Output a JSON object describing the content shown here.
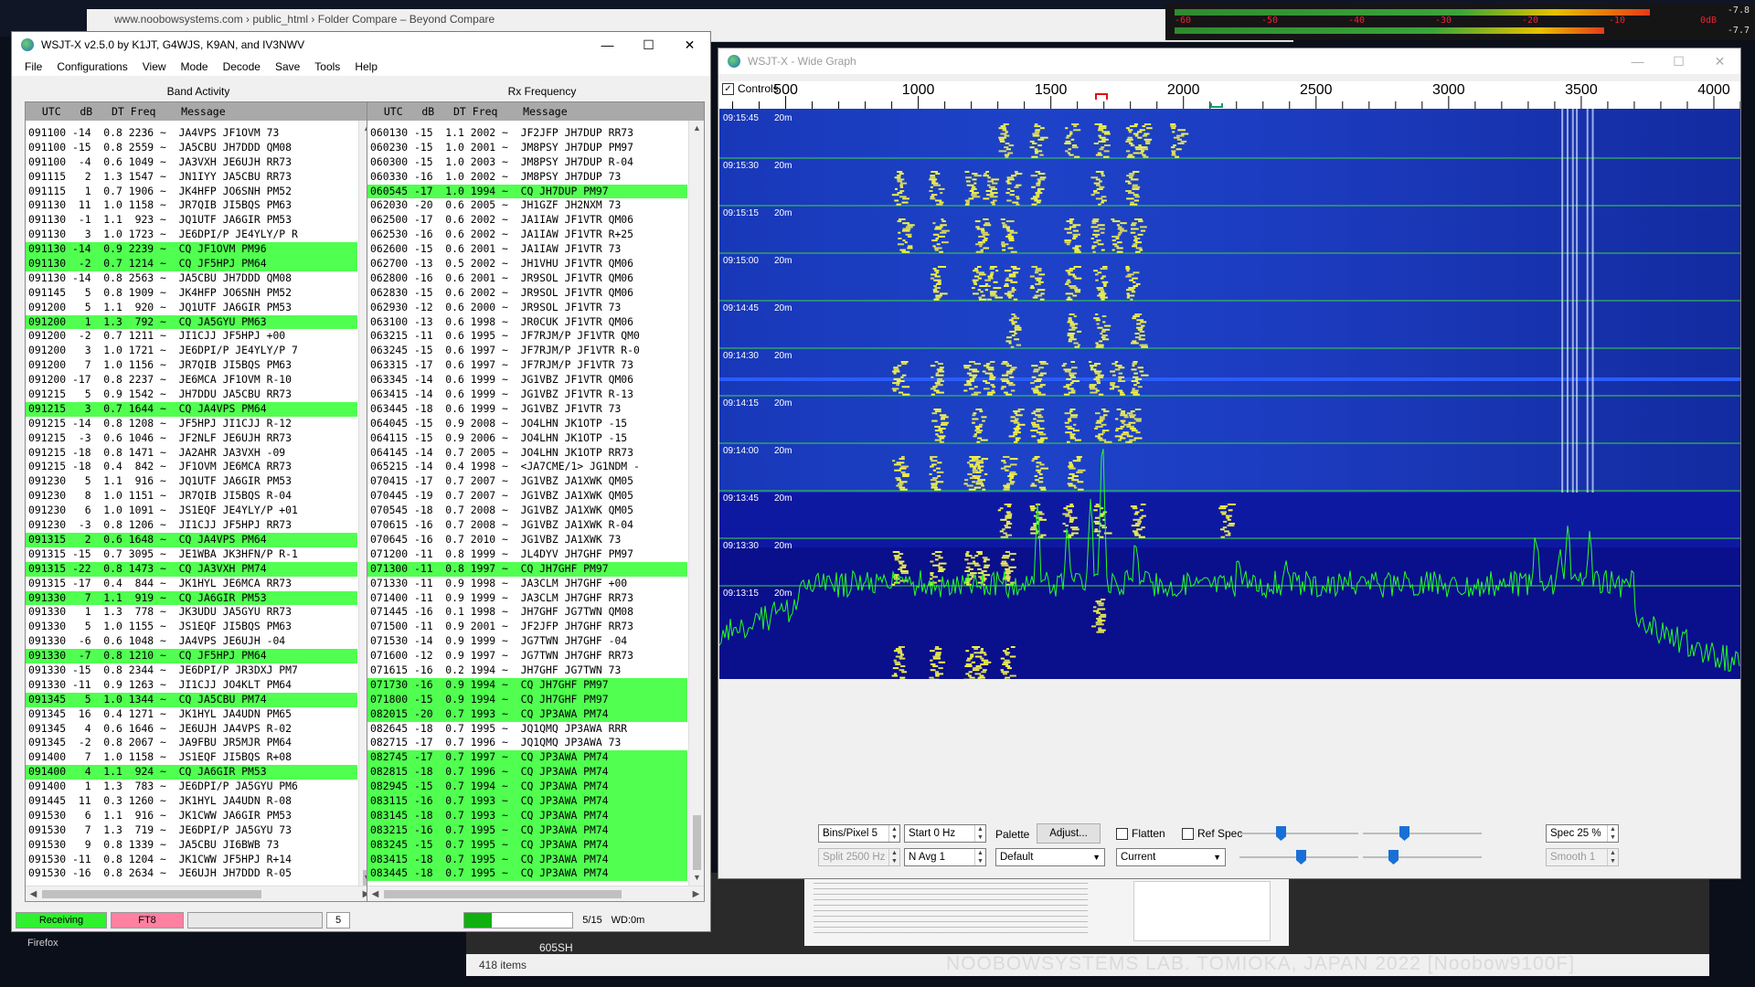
{
  "background": {
    "explorer_title": "www.noobowsystems.com  ›  public_html  ›  Folder Compare – Beyond Compare",
    "meter_scale": [
      "-60",
      "-50",
      "-40",
      "-30",
      "-20",
      "-10",
      "0dB"
    ],
    "meter_right_values": [
      "-7.8",
      "-7.7"
    ],
    "items_count": "418 items",
    "file_label": "605SH",
    "taskbar_label": "Firefox",
    "watermark": "NOOBOWSYSTEMS LAB. TOMIOKA, JAPAN 2022 [Noobow9100F]"
  },
  "wsjt": {
    "title": "WSJT-X   v2.5.0   by K1JT, G4WJS, K9AN, and IV3NWV",
    "menu": [
      "File",
      "Configurations",
      "View",
      "Mode",
      "Decode",
      "Save",
      "Tools",
      "Help"
    ],
    "band_title": "Band Activity",
    "rx_title": "Rx Frequency",
    "header": "  UTC   dB   DT Freq    Message",
    "band_rows": [
      {
        "t": "091100 -14  0.8 2236 ~  JA4VPS JF1OVM 73",
        "cq": false
      },
      {
        "t": "091100 -15  0.8 2559 ~  JA5CBU JH7DDD QM08",
        "cq": false
      },
      {
        "t": "091100  -4  0.6 1049 ~  JA3VXH JE6UJH RR73",
        "cq": false
      },
      {
        "t": "091115   2  1.3 1547 ~  JN1IYY JA5CBU RR73",
        "cq": false
      },
      {
        "t": "091115   1  0.7 1906 ~  JK4HFP JO6SNH PM52",
        "cq": false
      },
      {
        "t": "091130  11  1.0 1158 ~  JR7QIB JI5BQS PM63",
        "cq": false
      },
      {
        "t": "091130  -1  1.1  923 ~  JQ1UTF JA6GIR PM53",
        "cq": false
      },
      {
        "t": "091130   3  1.0 1723 ~  JE6DPI/P JE4YLY/P R",
        "cq": false
      },
      {
        "t": "091130 -14  0.9 2239 ~  CQ JF1OVM PM96",
        "cq": true
      },
      {
        "t": "091130  -2  0.7 1214 ~  CQ JF5HPJ PM64",
        "cq": true
      },
      {
        "t": "091130 -14  0.8 2563 ~  JA5CBU JH7DDD QM08",
        "cq": false
      },
      {
        "t": "091145   5  0.8 1909 ~  JK4HFP JO6SNH PM52",
        "cq": false
      },
      {
        "t": "091200   5  1.1  920 ~  JQ1UTF JA6GIR PM53",
        "cq": false
      },
      {
        "t": "091200   1  1.3  792 ~  CQ JA5GYU PM63",
        "cq": true
      },
      {
        "t": "091200  -2  0.7 1211 ~  JI1CJJ JF5HPJ +00",
        "cq": false
      },
      {
        "t": "091200   3  1.0 1721 ~  JE6DPI/P JE4YLY/P 7",
        "cq": false
      },
      {
        "t": "091200   7  1.0 1156 ~  JR7QIB JI5BQS PM63",
        "cq": false
      },
      {
        "t": "091200 -17  0.8 2237 ~  JE6MCA JF1OVM R-10",
        "cq": false
      },
      {
        "t": "091215   5  0.9 1542 ~  JH7DDU JA5CBU RR73",
        "cq": false
      },
      {
        "t": "091215   3  0.7 1644 ~  CQ JA4VPS PM64",
        "cq": true
      },
      {
        "t": "091215 -14  0.8 1208 ~  JF5HPJ JI1CJJ R-12",
        "cq": false
      },
      {
        "t": "091215  -3  0.6 1046 ~  JF2NLF JE6UJH RR73",
        "cq": false
      },
      {
        "t": "091215 -18  0.8 1471 ~  JA2AHR JA3VXH -09",
        "cq": false
      },
      {
        "t": "091215 -18  0.4  842 ~  JF1OVM JE6MCA RR73",
        "cq": false
      },
      {
        "t": "091230   5  1.1  916 ~  JQ1UTF JA6GIR PM53",
        "cq": false
      },
      {
        "t": "091230   8  1.0 1151 ~  JR7QIB JI5BQS R-04",
        "cq": false
      },
      {
        "t": "091230   6  1.0 1091 ~  JS1EQF JE4YLY/P +01",
        "cq": false
      },
      {
        "t": "091230  -3  0.8 1206 ~  JI1CJJ JF5HPJ RR73",
        "cq": false
      },
      {
        "t": "091315   2  0.6 1648 ~  CQ JA4VPS PM64",
        "cq": true
      },
      {
        "t": "091315 -15  0.7 3095 ~  JE1WBA JK3HFN/P R-1",
        "cq": false
      },
      {
        "t": "091315 -22  0.8 1473 ~  CQ JA3VXH PM74",
        "cq": true
      },
      {
        "t": "091315 -17  0.4  844 ~  JK1HYL JE6MCA RR73",
        "cq": false
      },
      {
        "t": "091330   7  1.1  919 ~  CQ JA6GIR PM53",
        "cq": true
      },
      {
        "t": "091330   1  1.3  778 ~  JK3UDU JA5GYU RR73",
        "cq": false
      },
      {
        "t": "091330   5  1.0 1155 ~  JS1EQF JI5BQS PM63",
        "cq": false
      },
      {
        "t": "091330  -6  0.6 1048 ~  JA4VPS JE6UJH -04",
        "cq": false
      },
      {
        "t": "091330  -7  0.8 1210 ~  CQ JF5HPJ PM64",
        "cq": true
      },
      {
        "t": "091330 -15  0.8 2344 ~  JE6DPI/P JR3DXJ PM7",
        "cq": false
      },
      {
        "t": "091330 -11  0.9 1263 ~  JI1CJJ JO4KLT PM64",
        "cq": false
      },
      {
        "t": "091345   5  1.0 1344 ~  CQ JA5CBU PM74",
        "cq": true
      },
      {
        "t": "091345  16  0.4 1271 ~  JK1HYL JA4UDN PM65",
        "cq": false
      },
      {
        "t": "091345   4  0.6 1646 ~  JE6UJH JA4VPS R-02",
        "cq": false
      },
      {
        "t": "091345  -2  0.8 2067 ~  JA9FBU JR5MJR PM64",
        "cq": false
      },
      {
        "t": "091400   7  1.0 1158 ~  JS1EQF JI5BQS R+08",
        "cq": false
      },
      {
        "t": "091400   4  1.1  924 ~  CQ JA6GIR PM53",
        "cq": true
      },
      {
        "t": "091400   1  1.3  783 ~  JE6DPI/P JA5GYU PM6",
        "cq": false
      },
      {
        "t": "091445  11  0.3 1260 ~  JK1HYL JA4UDN R-08",
        "cq": false
      },
      {
        "t": "091530   6  1.1  916 ~  JK1CWW JA6GIR PM53",
        "cq": false
      },
      {
        "t": "091530   7  1.3  719 ~  JE6DPI/P JA5GYU 73",
        "cq": false
      },
      {
        "t": "091530   9  0.8 1339 ~  JA5CBU JI6BWB 73",
        "cq": false
      },
      {
        "t": "091530 -11  0.8 1204 ~  JK1CWW JF5HPJ R+14",
        "cq": false
      },
      {
        "t": "091530 -16  0.8 2634 ~  JE6UJH JH7DDD R-05",
        "cq": false
      }
    ],
    "rx_rows": [
      {
        "t": "060130 -15  1.1 2002 ~  JF2JFP JH7DUP RR73",
        "cq": false
      },
      {
        "t": "060230 -15  1.0 2001 ~  JM8PSY JH7DUP PM97",
        "cq": false
      },
      {
        "t": "060300 -15  1.0 2003 ~  JM8PSY JH7DUP R-04",
        "cq": false
      },
      {
        "t": "060330 -16  1.0 2002 ~  JM8PSY JH7DUP 73",
        "cq": false
      },
      {
        "t": "060545 -17  1.0 1994 ~  CQ JH7DUP PM97",
        "cq": true
      },
      {
        "t": "062030 -20  0.6 2005 ~  JH1GZF JH2NXM 73",
        "cq": false
      },
      {
        "t": "062500 -17  0.6 2002 ~  JA1IAW JF1VTR QM06",
        "cq": false
      },
      {
        "t": "062530 -16  0.6 2002 ~  JA1IAW JF1VTR R+25",
        "cq": false
      },
      {
        "t": "062600 -15  0.6 2001 ~  JA1IAW JF1VTR 73",
        "cq": false
      },
      {
        "t": "062700 -13  0.5 2002 ~  JH1VHU JF1VTR QM06",
        "cq": false
      },
      {
        "t": "062800 -16  0.6 2001 ~  JR9SOL JF1VTR QM06",
        "cq": false
      },
      {
        "t": "062830 -15  0.6 2002 ~  JR9SOL JF1VTR QM06",
        "cq": false
      },
      {
        "t": "062930 -12  0.6 2000 ~  JR9SOL JF1VTR 73",
        "cq": false
      },
      {
        "t": "063100 -13  0.6 1998 ~  JR0CUK JF1VTR QM06",
        "cq": false
      },
      {
        "t": "063215 -11  0.6 1995 ~  JF7RJM/P JF1VTR QM0",
        "cq": false
      },
      {
        "t": "063245 -15  0.6 1997 ~  JF7RJM/P JF1VTR R-0",
        "cq": false
      },
      {
        "t": "063315 -17  0.6 1997 ~  JF7RJM/P JF1VTR 73",
        "cq": false
      },
      {
        "t": "063345 -14  0.6 1999 ~  JG1VBZ JF1VTR QM06",
        "cq": false
      },
      {
        "t": "063415 -14  0.6 1999 ~  JG1VBZ JF1VTR R-13",
        "cq": false
      },
      {
        "t": "063445 -18  0.6 1999 ~  JG1VBZ JF1VTR 73",
        "cq": false
      },
      {
        "t": "064045 -15  0.9 2008 ~  JO4LHN JK1OTP -15",
        "cq": false
      },
      {
        "t": "064115 -15  0.9 2006 ~  JO4LHN JK1OTP -15",
        "cq": false
      },
      {
        "t": "064145 -14  0.7 2005 ~  JO4LHN JK1OTP RR73",
        "cq": false
      },
      {
        "t": "065215 -14  0.4 1998 ~  <JA7CME/1> JG1NDM -",
        "cq": false
      },
      {
        "t": "070415 -17  0.7 2007 ~  JG1VBZ JA1XWK QM05",
        "cq": false
      },
      {
        "t": "070445 -19  0.7 2007 ~  JG1VBZ JA1XWK QM05",
        "cq": false
      },
      {
        "t": "070545 -18  0.7 2008 ~  JG1VBZ JA1XWK QM05",
        "cq": false
      },
      {
        "t": "070615 -16  0.7 2008 ~  JG1VBZ JA1XWK R-04",
        "cq": false
      },
      {
        "t": "070645 -16  0.7 2010 ~  JG1VBZ JA1XWK 73",
        "cq": false
      },
      {
        "t": "071200 -11  0.8 1999 ~  JL4DYV JH7GHF PM97",
        "cq": false
      },
      {
        "t": "071300 -11  0.8 1997 ~  CQ JH7GHF PM97",
        "cq": true
      },
      {
        "t": "071330 -11  0.9 1998 ~  JA3CLM JH7GHF +00",
        "cq": false
      },
      {
        "t": "071400 -11  0.9 1999 ~  JA3CLM JH7GHF RR73",
        "cq": false
      },
      {
        "t": "071445 -16  0.1 1998 ~  JH7GHF JG7TWN QM08",
        "cq": false
      },
      {
        "t": "071500 -11  0.9 2001 ~  JF2JFP JH7GHF RR73",
        "cq": false
      },
      {
        "t": "071530 -14  0.9 1999 ~  JG7TWN JH7GHF -04",
        "cq": false
      },
      {
        "t": "071600 -12  0.9 1997 ~  JG7TWN JH7GHF RR73",
        "cq": false
      },
      {
        "t": "071615 -16  0.2 1994 ~  JH7GHF JG7TWN 73",
        "cq": false
      },
      {
        "t": "071730 -16  0.9 1994 ~  CQ JH7GHF PM97",
        "cq": true
      },
      {
        "t": "071800 -15  0.9 1994 ~  CQ JH7GHF PM97",
        "cq": true
      },
      {
        "t": "082015 -20  0.7 1993 ~  CQ JP3AWA PM74",
        "cq": true
      },
      {
        "t": "082645 -18  0.7 1995 ~  JQ1QMQ JP3AWA RRR",
        "cq": false
      },
      {
        "t": "082715 -17  0.7 1996 ~  JQ1QMQ JP3AWA 73",
        "cq": false
      },
      {
        "t": "082745 -17  0.7 1997 ~  CQ JP3AWA PM74",
        "cq": true
      },
      {
        "t": "082815 -18  0.7 1996 ~  CQ JP3AWA PM74",
        "cq": true
      },
      {
        "t": "082945 -15  0.7 1994 ~  CQ JP3AWA PM74",
        "cq": true
      },
      {
        "t": "083115 -16  0.7 1993 ~  CQ JP3AWA PM74",
        "cq": true
      },
      {
        "t": "083145 -18  0.7 1993 ~  CQ JP3AWA PM74",
        "cq": true
      },
      {
        "t": "083215 -16  0.7 1995 ~  CQ JP3AWA PM74",
        "cq": true
      },
      {
        "t": "083245 -15  0.7 1995 ~  CQ JP3AWA PM74",
        "cq": true
      },
      {
        "t": "083415 -18  0.7 1995 ~  CQ JP3AWA PM74",
        "cq": true
      },
      {
        "t": "083445 -18  0.7 1995 ~  CQ JP3AWA PM74",
        "cq": true
      }
    ],
    "status": {
      "receiving": "Receiving",
      "mode": "FT8",
      "tx_count": "5",
      "progress_fraction": 0.25,
      "period": "5/15",
      "wd": "WD:0m"
    },
    "colors": {
      "cq_highlight": "#50ff50",
      "receiving": "#30f030",
      "mode": "#ff80a0"
    }
  },
  "wide": {
    "title": "WSJT-X - Wide Graph",
    "controls_label": "Controls",
    "freq_ticks": [
      "500",
      "1000",
      "1500",
      "2000",
      "2500",
      "3000",
      "3500",
      "4000"
    ],
    "time_labels": [
      "09:15:45",
      "09:15:30",
      "09:15:15",
      "09:15:00",
      "09:14:45",
      "09:14:30",
      "09:14:15",
      "09:14:00",
      "09:13:45",
      "09:13:30",
      "09:13:15"
    ],
    "band_label": "20m",
    "bins_pixel": "Bins/Pixel  5",
    "start": "Start 0 Hz",
    "palette_label": "Palette",
    "adjust_label": "Adjust...",
    "flatten_label": "Flatten",
    "refspec_label": "Ref Spec",
    "spec": "Spec 25 %",
    "split": "Split  2500  Hz",
    "navg": "N Avg  1",
    "palette_value": "Default",
    "current_value": "Current",
    "smooth": "Smooth   1"
  }
}
